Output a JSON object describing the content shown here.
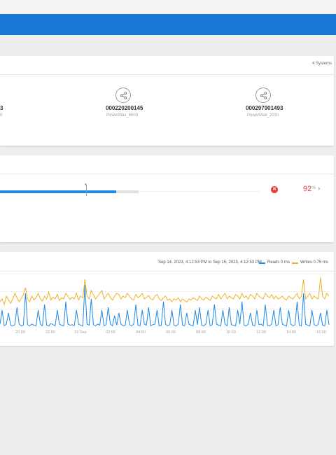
{
  "header": {
    "title": ""
  },
  "systems": {
    "count_label": "4 Systems",
    "items": [
      {
        "id": "3",
        "model": "0"
      },
      {
        "id": "000220200145",
        "model": "PowerMax_8500"
      },
      {
        "id": "000297901493",
        "model": "PowerMax_2000"
      }
    ]
  },
  "capacity": {
    "percent": "92",
    "unit": "%",
    "fill_fraction": 0.92,
    "status": "error"
  },
  "performance": {
    "range": "Sep 14, 2023, 4:12:53 PM to Sep 15, 2023, 4:12:53 PM",
    "legend": [
      {
        "label": "Reads 0 ms",
        "color": "#1e88e5"
      },
      {
        "label": "Writes 0.75 ms",
        "color": "#f2b01e"
      }
    ]
  },
  "chart_data": {
    "type": "line",
    "title": "",
    "xlabel": "",
    "ylabel": "",
    "x_ticks": [
      "20:00",
      "22:00",
      "15 Sep",
      "02:00",
      "04:00",
      "06:00",
      "08:00",
      "10:00",
      "12:00",
      "14:00",
      "16:00"
    ],
    "grid": true,
    "series": [
      {
        "name": "Reads",
        "color": "#1e88e5",
        "values": [
          0.05,
          0.3,
          0.02,
          0.05,
          0.25,
          0.03,
          0.02,
          0.04,
          0.35,
          0.05,
          0.02,
          0.03,
          0.6,
          0.04,
          0.02,
          0.05,
          0.03,
          0.02,
          0.3,
          0.05,
          0.02,
          0.4,
          0.03,
          0.02,
          0.06,
          0.04,
          0.02,
          0.3,
          0.05,
          0.03,
          0.02,
          0.45,
          0.05,
          0.03,
          0.04,
          0.02,
          0.3,
          0.05,
          0.03,
          0.02,
          0.75,
          0.05,
          0.03,
          0.5,
          0.04,
          0.02,
          0.05,
          0.03,
          0.3,
          0.02,
          0.04,
          0.35,
          0.05,
          0.02,
          0.2,
          0.03,
          0.25,
          0.05,
          0.02,
          0.03,
          0.3,
          0.04,
          0.02,
          0.05,
          0.4,
          0.03,
          0.02,
          0.3,
          0.05,
          0.03,
          0.35,
          0.02,
          0.04,
          0.05,
          0.3,
          0.02,
          0.03,
          0.45,
          0.05,
          0.02,
          0.04,
          0.3,
          0.03,
          0.02,
          0.05,
          0.4,
          0.03,
          0.02,
          0.25,
          0.05,
          0.03,
          0.02,
          0.3,
          0.04,
          0.35,
          0.03,
          0.02,
          0.05,
          0.3,
          0.02,
          0.04,
          0.4,
          0.05,
          0.03,
          0.02,
          0.3,
          0.05,
          0.02,
          0.35,
          0.04,
          0.03,
          0.02,
          0.3,
          0.05,
          0.45,
          0.03,
          0.02,
          0.05,
          0.25,
          0.03,
          0.02,
          0.3,
          0.04,
          0.05,
          0.02,
          0.4,
          0.03,
          0.02,
          0.05,
          0.3,
          0.02,
          0.04,
          0.35,
          0.05,
          0.03,
          0.02,
          0.3,
          0.05,
          0.02,
          0.04,
          0.45,
          0.03,
          0.02,
          0.6,
          0.05,
          0.03,
          0.02,
          0.3,
          0.04,
          0.02,
          0.05,
          0.25,
          0.03,
          0.02,
          0.3,
          0.04
        ]
      },
      {
        "name": "Writes",
        "color": "#f2b01e",
        "values": [
          0.45,
          0.5,
          0.4,
          0.55,
          0.48,
          0.42,
          0.5,
          0.6,
          0.52,
          0.45,
          0.5,
          0.58,
          0.7,
          0.5,
          0.45,
          0.55,
          0.48,
          0.52,
          0.6,
          0.5,
          0.46,
          0.55,
          0.5,
          0.62,
          0.48,
          0.53,
          0.5,
          0.58,
          0.47,
          0.52,
          0.5,
          0.6,
          0.55,
          0.49,
          0.53,
          0.5,
          0.6,
          0.48,
          0.55,
          0.52,
          0.85,
          0.55,
          0.5,
          0.65,
          0.58,
          0.5,
          0.55,
          0.6,
          0.65,
          0.5,
          0.55,
          0.6,
          0.52,
          0.48,
          0.55,
          0.6,
          0.58,
          0.5,
          0.55,
          0.52,
          0.6,
          0.55,
          0.5,
          0.48,
          0.58,
          0.52,
          0.55,
          0.6,
          0.5,
          0.53,
          0.56,
          0.5,
          0.48,
          0.55,
          0.58,
          0.5,
          0.47,
          0.52,
          0.55,
          0.48,
          0.5,
          0.45,
          0.5,
          0.48,
          0.52,
          0.45,
          0.5,
          0.47,
          0.44,
          0.5,
          0.48,
          0.52,
          0.5,
          0.47,
          0.55,
          0.5,
          0.48,
          0.53,
          0.5,
          0.47,
          0.55,
          0.52,
          0.5,
          0.58,
          0.5,
          0.55,
          0.6,
          0.5,
          0.55,
          0.52,
          0.5,
          0.58,
          0.55,
          0.5,
          0.6,
          0.52,
          0.55,
          0.5,
          0.58,
          0.55,
          0.5,
          0.6,
          0.55,
          0.52,
          0.5,
          0.6,
          0.55,
          0.52,
          0.58,
          0.5,
          0.55,
          0.5,
          0.52,
          0.55,
          0.5,
          0.48,
          0.55,
          0.52,
          0.5,
          0.55,
          0.6,
          0.5,
          0.55,
          0.85,
          0.5,
          0.55,
          0.6,
          0.5,
          0.55,
          0.52,
          0.5,
          0.88,
          0.55,
          0.5,
          0.6,
          0.55
        ]
      }
    ]
  }
}
